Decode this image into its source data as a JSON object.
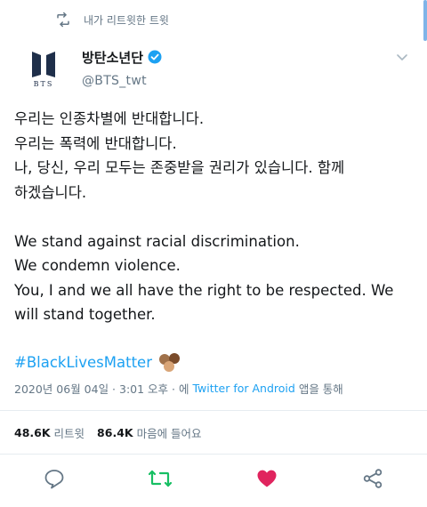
{
  "retweet_header": {
    "label": "내가 리트윗한 트윗",
    "icon": "retweet-icon"
  },
  "author": {
    "display_name": "방탄소년단",
    "handle": "@BTS_twt",
    "avatar_text": "BTS",
    "verified": true
  },
  "tweet": {
    "lines_ko": [
      "우리는 인종차별에 반대합니다.",
      "우리는 폭력에 반대합니다.",
      "나, 당신, 우리 모두는 존중받을 권리가 있습니다. 함께",
      "하겠습니다."
    ],
    "lines_en": [
      "We stand against racial discrimination.",
      "We condemn violence.",
      "You, I and we all have the right to be respected. We",
      "will stand together."
    ],
    "hashtag": "#BlackLivesMatter"
  },
  "meta": {
    "date_time": "2020년 06월 04일 · 3:01 오후 · 에",
    "source": "Twitter for Android",
    "suffix": "앱을 통해"
  },
  "stats": {
    "retweets": "48.6K",
    "retweets_label": "리트윗",
    "likes": "86.4K",
    "likes_label": "마음에 들어요"
  },
  "colors": {
    "accent": "#1da1f2",
    "retweeted": "#17bf63",
    "liked": "#e0245e",
    "secondary_text": "#657786"
  },
  "actions": {
    "reply": "reply-icon",
    "retweet": "retweet-icon",
    "like": "heart-icon",
    "share": "share-icon"
  }
}
